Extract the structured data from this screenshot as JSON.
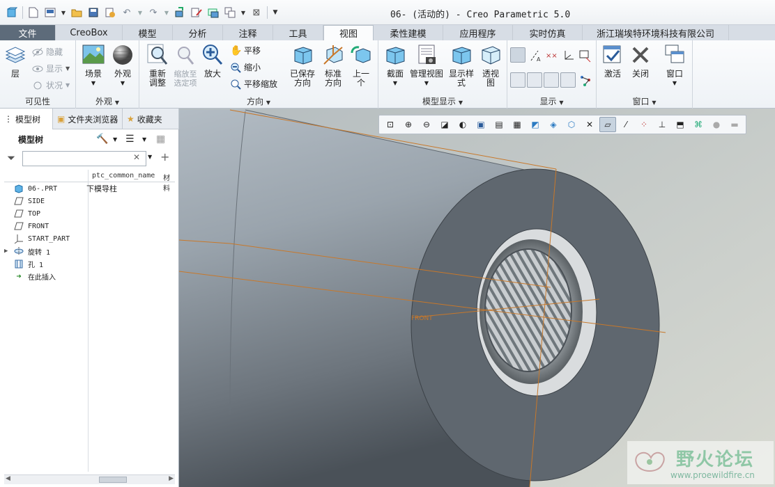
{
  "window": {
    "title": "06- (活动的) - Creo Parametric 5.0"
  },
  "tabs": [
    {
      "label": "文件"
    },
    {
      "label": "CreoBox"
    },
    {
      "label": "模型"
    },
    {
      "label": "分析"
    },
    {
      "label": "注释"
    },
    {
      "label": "工具"
    },
    {
      "label": "视图"
    },
    {
      "label": "柔性建模"
    },
    {
      "label": "应用程序"
    },
    {
      "label": "实时仿真"
    },
    {
      "label": "浙江瑞埃特环境科技有限公司"
    }
  ],
  "ribbon": {
    "visibility": {
      "label": "可见性",
      "layer": "层",
      "hide": "隐藏",
      "show": "显示",
      "status": "状况"
    },
    "appearance": {
      "label": "外观",
      "scene": "场景",
      "appearance": "外观"
    },
    "orientation": {
      "label": "方向",
      "refit": "重新调整",
      "zoom_to_selected": "缩放至选定项",
      "zoom_in": "放大",
      "pan": "平移",
      "zoom_out": "缩小",
      "pan_zoom": "平移缩放",
      "saved_orient": "已保存方向",
      "standard_orient": "标准方向",
      "previous": "上一个"
    },
    "model_display": {
      "label": "模型显示",
      "section": "截面",
      "manage_views": "管理视图",
      "display_style": "显示样式",
      "perspective": "透视图"
    },
    "show": {
      "label": "显示"
    },
    "window": {
      "label": "窗口",
      "activate": "激活",
      "close": "关闭",
      "windows": "窗口"
    }
  },
  "panel": {
    "tabs": [
      "模型树",
      "文件夹浏览器",
      "收藏夹"
    ],
    "tree_title": "模型树",
    "filter_placeholder": "",
    "columns": [
      "ptc_common_name",
      "材料"
    ],
    "rows": [
      {
        "name": "06-.PRT",
        "value": "下模导柱",
        "icon": "part-icon"
      },
      {
        "name": "SIDE",
        "value": "",
        "icon": "datum-plane-icon"
      },
      {
        "name": "TOP",
        "value": "",
        "icon": "datum-plane-icon"
      },
      {
        "name": "FRONT",
        "value": "",
        "icon": "datum-plane-icon"
      },
      {
        "name": "START_PART",
        "value": "",
        "icon": "coordinate-system-icon"
      },
      {
        "name": "旋转 1",
        "value": "",
        "icon": "revolve-icon"
      },
      {
        "name": "孔 1",
        "value": "",
        "icon": "hole-icon"
      },
      {
        "name": "在此插入",
        "value": "",
        "icon": "insert-here-icon"
      }
    ]
  },
  "viewport": {
    "datum_label": "FRONT"
  },
  "watermark": {
    "name": "野火论坛",
    "url": "www.proewildfire.cn"
  },
  "colors": {
    "accent": "#2b5c9a",
    "model_gray": "#5f676f",
    "datum": "#c8782a"
  }
}
